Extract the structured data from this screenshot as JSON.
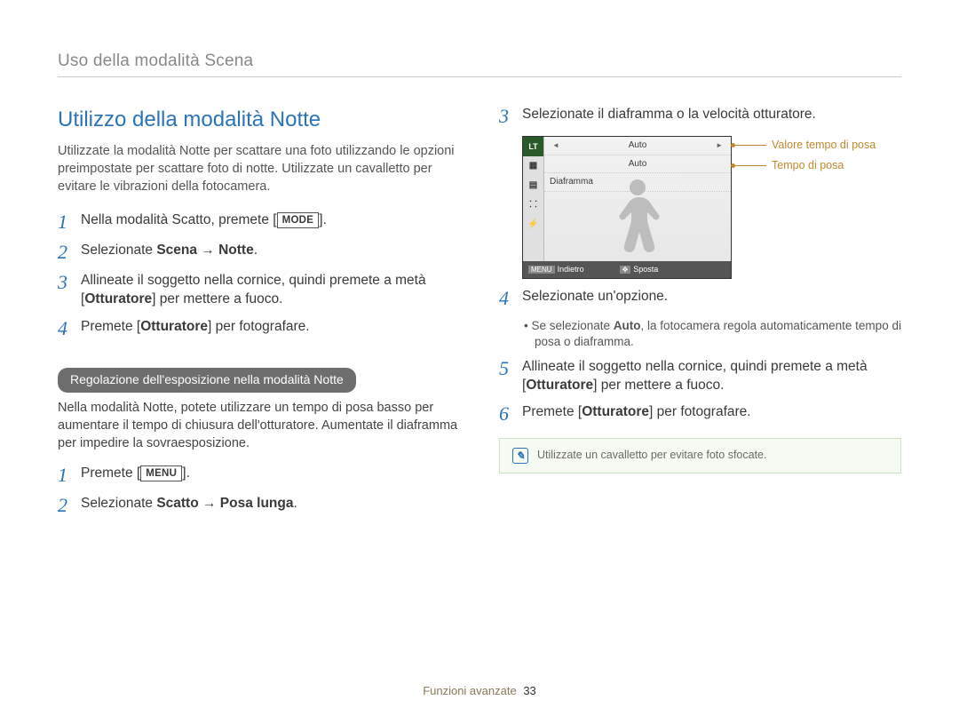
{
  "header": "Uso della modalità Scena",
  "left": {
    "title": "Utilizzo della modalità Notte",
    "intro": "Utilizzate la modalità Notte per scattare una foto utilizzando le opzioni preimpostate per scattare foto di notte. Utilizzate un cavalletto per evitare le vibrazioni della fotocamera.",
    "steps": {
      "1_pre": "Nella modalità Scatto, premete [",
      "1_key": "MODE",
      "1_post": "].",
      "2_pre": "Selezionate ",
      "2_bold": "Scena → Notte",
      "2_post": ".",
      "3_pre": "Allineate il soggetto nella cornice, quindi premete a metà [",
      "3_bold": "Otturatore",
      "3_post": "] per mettere a fuoco.",
      "4_pre": "Premete [",
      "4_bold": "Otturatore",
      "4_post": "] per fotografare."
    },
    "pill": "Regolazione dell'esposizione nella modalità Notte",
    "sub_intro": "Nella modalità Notte, potete utilizzare un tempo di posa basso per aumentare il tempo di chiusura dell'otturatore. Aumentate il diaframma per impedire la sovraesposizione.",
    "sub_steps": {
      "1_pre": "Premete [",
      "1_key": "MENU",
      "1_post": "].",
      "2_pre": "Selezionate ",
      "2_bold": "Scatto → Posa lunga",
      "2_post": "."
    }
  },
  "right": {
    "steps": {
      "3": "Selezionate il diaframma o la velocità otturatore.",
      "4": "Selezionate un'opzione.",
      "4_sub_pre": "Se selezionate ",
      "4_sub_bold": "Auto",
      "4_sub_post": ", la fotocamera regola automaticamente tempo di posa o diaframma.",
      "5_pre": "Allineate il soggetto nella cornice, quindi premete a metà [",
      "5_bold": "Otturatore",
      "5_post": "] per mettere a fuoco.",
      "6_pre": "Premete [",
      "6_bold": "Otturatore",
      "6_post": "] per fotografare."
    },
    "lcd": {
      "lt": "LT",
      "row1": "Auto",
      "row2": "Auto",
      "row3": "Diaframma",
      "back_key": "MENU",
      "back": "Indietro",
      "move_key": "✥",
      "move": "Sposta",
      "label1": "Valore tempo di posa",
      "label2": "Tempo di posa"
    },
    "note": "Utilizzate un cavalletto per evitare foto sfocate."
  },
  "footer": {
    "section": "Funzioni avanzate",
    "page": "33"
  }
}
